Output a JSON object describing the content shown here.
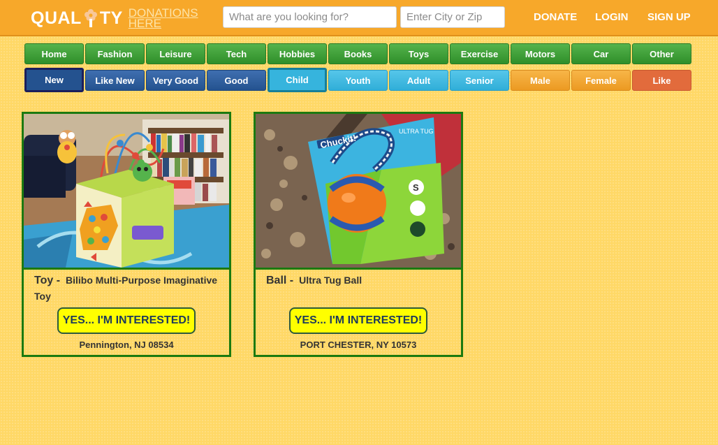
{
  "header": {
    "logo_main_left": "QUAL",
    "logo_main_right": "TY",
    "logo_sub_line1": "DONATIONS",
    "logo_sub_line2": "HERE",
    "search_placeholder": "What are you looking for?",
    "location_placeholder": "Enter City or Zip",
    "nav": {
      "donate": "DONATE",
      "login": "LOGIN",
      "signup": "SIGN UP"
    }
  },
  "categories": [
    "Home",
    "Fashion",
    "Leisure",
    "Tech",
    "Hobbies",
    "Books",
    "Toys",
    "Exercise",
    "Motors",
    "Car",
    "Other"
  ],
  "filters": {
    "condition": [
      "New",
      "Like New",
      "Very Good",
      "Good"
    ],
    "age": [
      "Child",
      "Youth",
      "Adult",
      "Senior"
    ],
    "gender": [
      "Male",
      "Female"
    ],
    "extra": "Like",
    "selected_condition": "New",
    "selected_age": "Child"
  },
  "listings": [
    {
      "category": "Toy -",
      "title": "Bilibo Multi-Purpose Imaginative Toy",
      "button": "YES... I'M INTERESTED!",
      "location": "Pennington, NJ 08534",
      "image_icon": "activity-cube-photo"
    },
    {
      "category": "Ball -",
      "title": "Ultra Tug Ball",
      "button": "YES... I'M INTERESTED!",
      "location": "PORT CHESTER, NY 10573",
      "image_icon": "dog-toy-ball-photo",
      "brand_label": "Chuckit!",
      "pack_label": "ULTRA TUG"
    }
  ],
  "colors": {
    "header_bg": "#f7a82a",
    "page_bg": "#ffd866",
    "card_border": "#1c7a10",
    "interest_button": "#ffff00"
  }
}
